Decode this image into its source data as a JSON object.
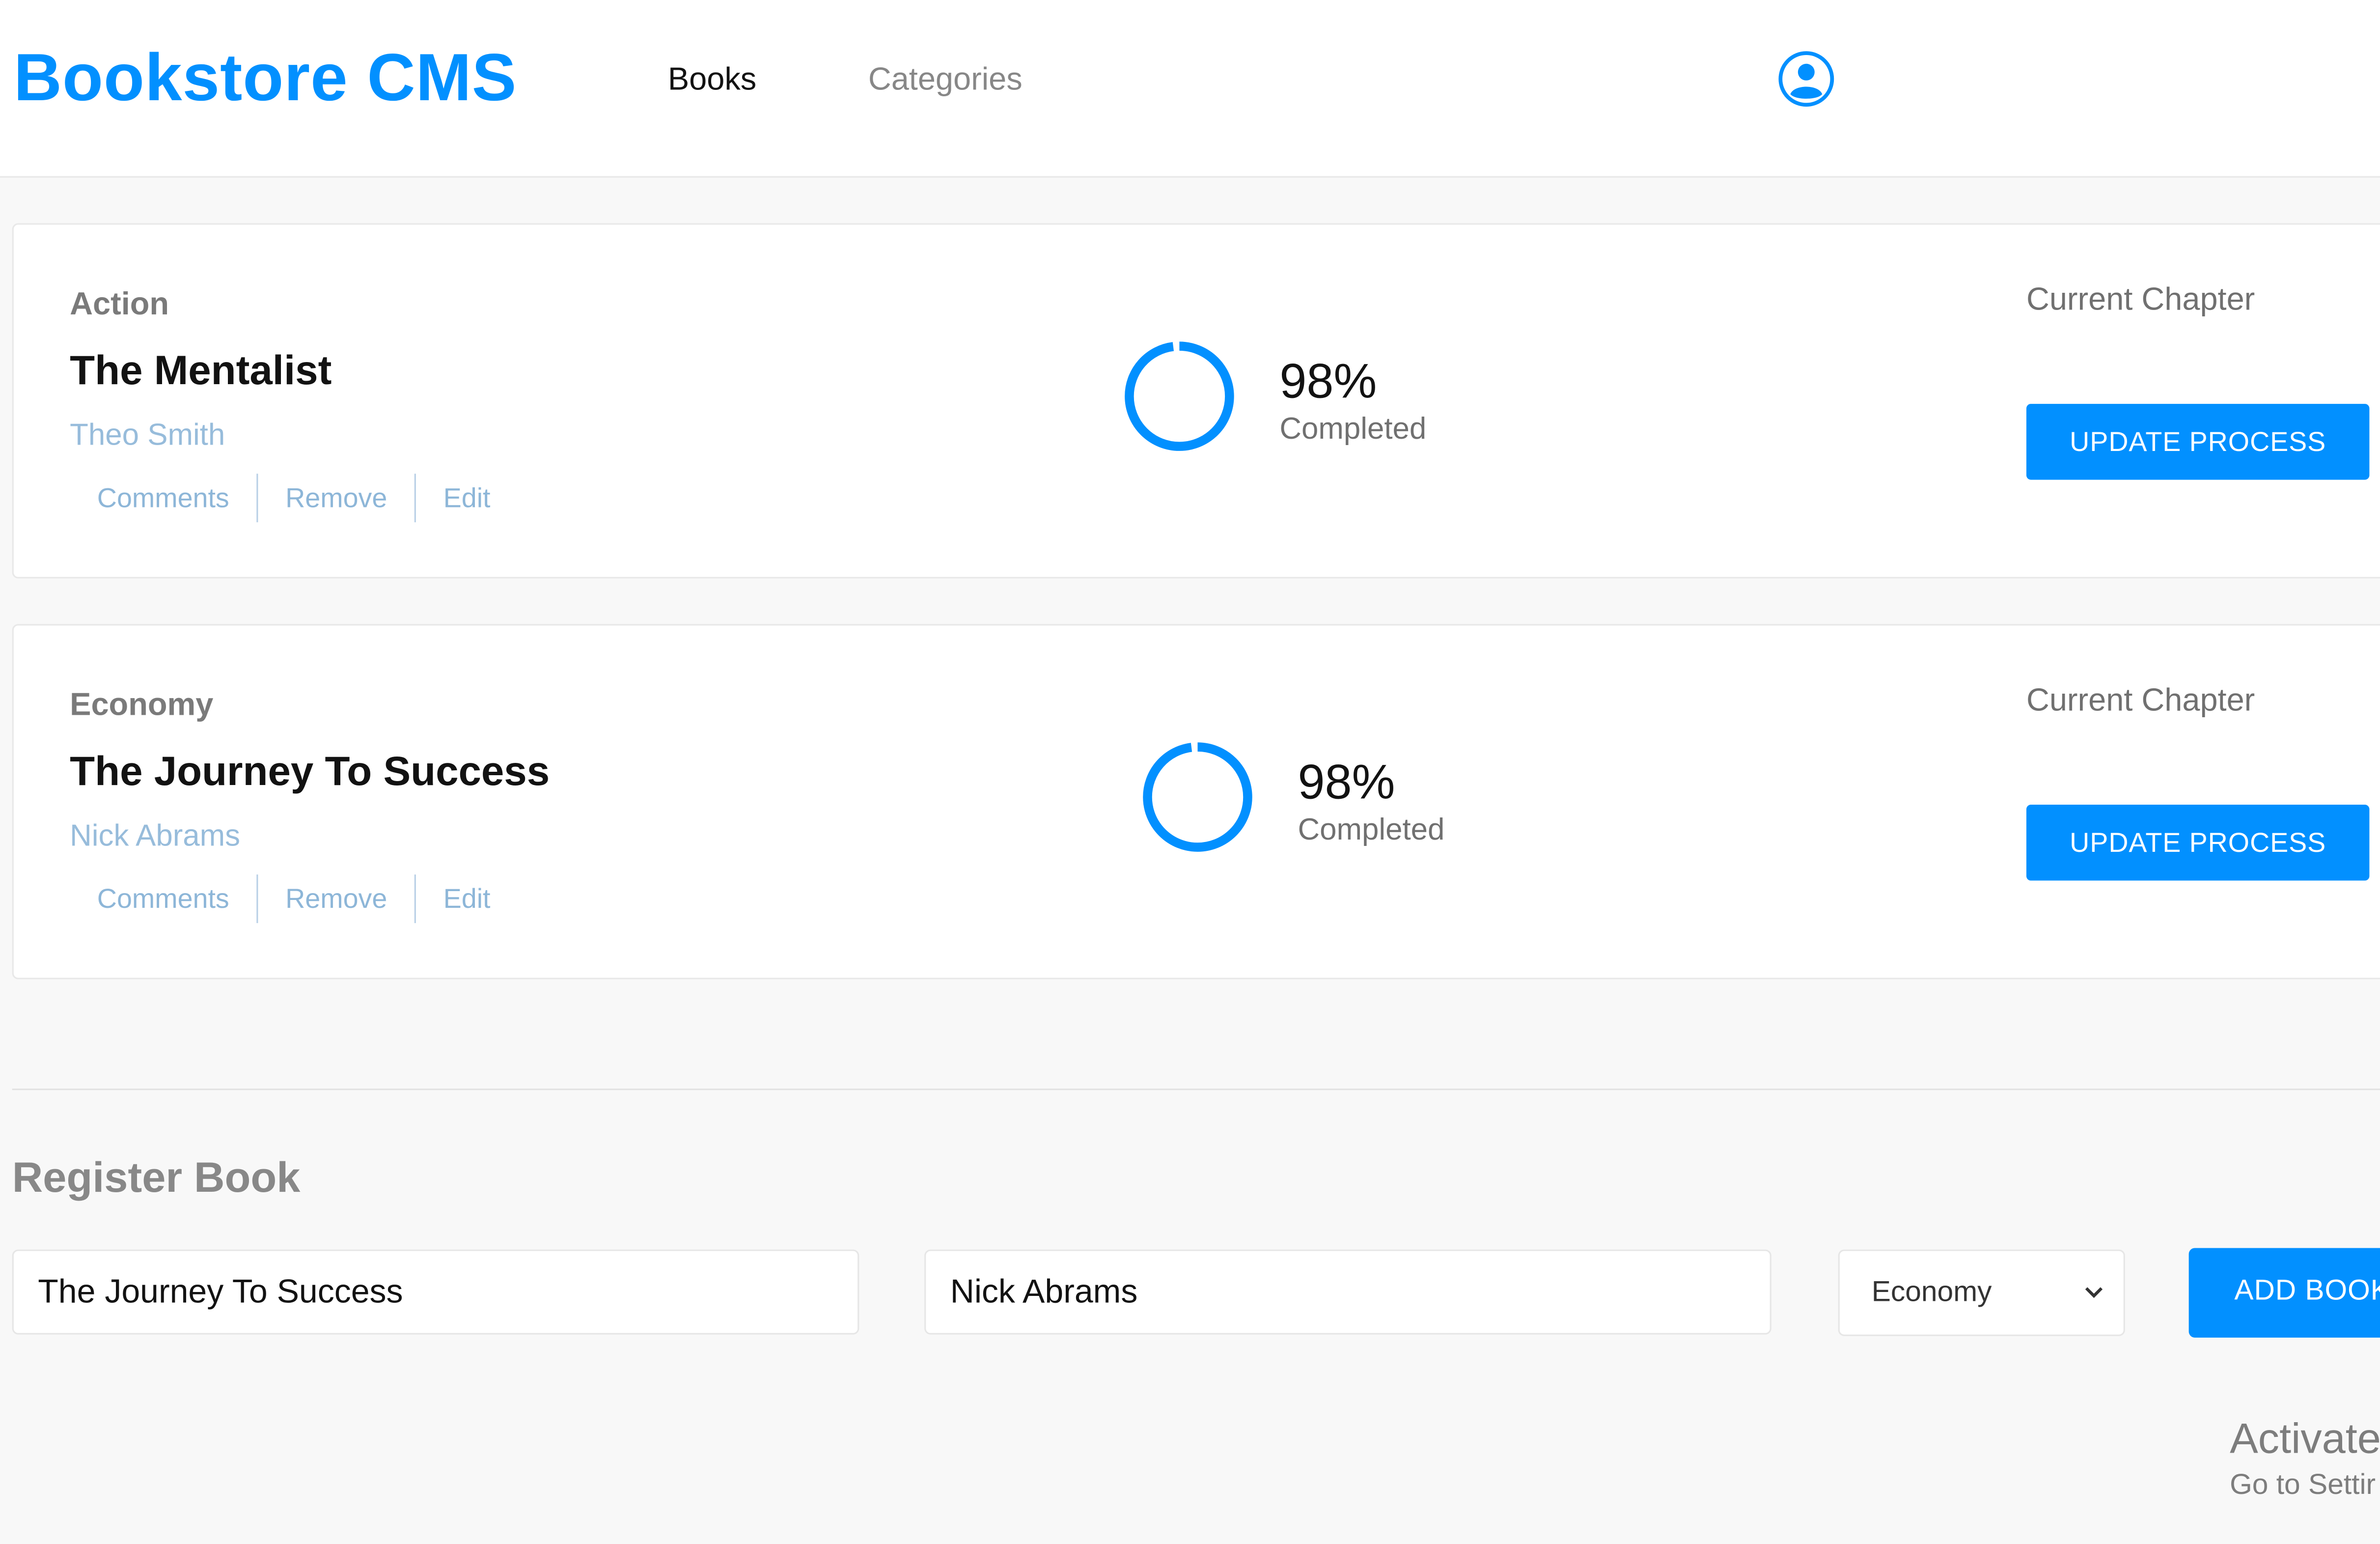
{
  "header": {
    "logo": "Bookstore CMS",
    "nav": [
      {
        "label": "Books"
      },
      {
        "label": "Categories"
      }
    ],
    "user_icon": "user-circle-icon"
  },
  "books": [
    {
      "category": "Action",
      "title": "The Mentalist",
      "author": "Theo Smith",
      "actions": [
        "Comments",
        "Remove",
        "Edit"
      ],
      "progress_percent": 98,
      "percent_label": "98%",
      "completed_label": "Completed",
      "chapter_label": "Current Chapter",
      "update_label": "UPDATE PROCESS"
    },
    {
      "category": "Economy",
      "title": "The Journey To Success",
      "author": "Nick Abrams",
      "actions": [
        "Comments",
        "Remove",
        "Edit"
      ],
      "progress_percent": 98,
      "percent_label": "98%",
      "completed_label": "Completed",
      "chapter_label": "Current Chapter",
      "update_label": "UPDATE PROCESS"
    }
  ],
  "register": {
    "title": "Register Book",
    "title_value": "The Journey To Success",
    "author_value": "Nick Abrams",
    "category_value": "Economy",
    "add_label": "ADD BOOK"
  },
  "watermark": {
    "line1": "Activate",
    "line2": "Go to Settir"
  },
  "colors": {
    "accent": "#0290ff",
    "author_link": "#4386bf",
    "background": "#f8f8f8"
  }
}
